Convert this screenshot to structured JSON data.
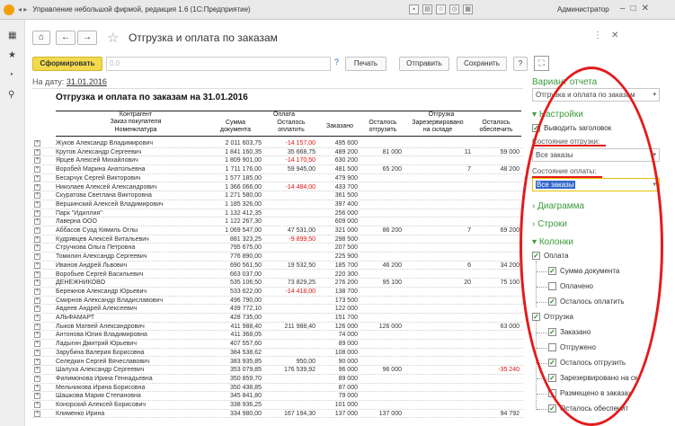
{
  "window": {
    "title": "Управление небольшой фирмой, редакция 1.6 (1С:Предприятие)",
    "user": "Администратор"
  },
  "header": {
    "title": "Отгрузка и оплата по заказам"
  },
  "toolbar": {
    "generate_label": "Сформировать",
    "field_value": "0.0",
    "help_label": "?",
    "print_label": "Печать",
    "send_label": "Отправить",
    "save_label": "Сохранить",
    "help2_label": "?"
  },
  "date_line": {
    "label": "На дату:",
    "value": "31.01.2016"
  },
  "report": {
    "title": "Отгрузка и оплата по заказам на 31.01.2016",
    "headers": {
      "counterparty": "Контрагент",
      "customer_order": "Заказ покупателя",
      "item": "Номенклатура",
      "payment": "Оплата",
      "doc_sum_1": "Сумма",
      "doc_sum_2": "документа",
      "remaining_1": "Осталось",
      "remaining_2": "оплатить",
      "ordered": "Заказано",
      "shipment": "Отгрузка",
      "to_ship_1": "Осталось",
      "to_ship_2": "отгрузить",
      "reserved_1": "Зарезервировано",
      "reserved_2": "на складе",
      "to_provide_1": "Осталось",
      "to_provide_2": "обеспечить"
    },
    "rows": [
      {
        "name": "Жуков Александр Владимирович",
        "sum": "2 011 603,75",
        "rem": "-14 157,00",
        "rem_red": true,
        "ordered": "495 600",
        "to_ship": "",
        "reserved": "",
        "to_provide": ""
      },
      {
        "name": "Крутов Александр Сергеевич",
        "sum": "1 841 160,35",
        "rem": "35 668,75",
        "rem_red": false,
        "ordered": "489 200",
        "to_ship": "81 000",
        "reserved": "11",
        "to_provide": "59 000"
      },
      {
        "name": "Ярцев Алексей Михайлович",
        "sum": "1 809 901,00",
        "rem": "-14 170,50",
        "rem_red": true,
        "ordered": "630 200",
        "to_ship": "",
        "reserved": "",
        "to_provide": ""
      },
      {
        "name": "Воробей Марина Анатольевна",
        "sum": "1 711 176,00",
        "rem": "59 945,00",
        "rem_red": false,
        "ordered": "481 500",
        "to_ship": "65 200",
        "reserved": "7",
        "to_provide": "48 200"
      },
      {
        "name": "Бесарчук Сергей Викторович",
        "sum": "1 577 185,00",
        "rem": "",
        "rem_red": false,
        "ordered": "479 900",
        "to_ship": "",
        "reserved": "",
        "to_provide": ""
      },
      {
        "name": "Николаев Алексей Александрович",
        "sum": "1 366 066,00",
        "rem": "-14 484,00",
        "rem_red": true,
        "ordered": "433 700",
        "to_ship": "",
        "reserved": "",
        "to_provide": ""
      },
      {
        "name": "Скуратова Светлана Викторовна",
        "sum": "1 271 580,00",
        "rem": "",
        "rem_red": false,
        "ordered": "361 500",
        "to_ship": "",
        "reserved": "",
        "to_provide": ""
      },
      {
        "name": "Вершинский Алексей Владимирович",
        "sum": "1 185 326,00",
        "rem": "",
        "rem_red": false,
        "ordered": "397 400",
        "to_ship": "",
        "reserved": "",
        "to_provide": ""
      },
      {
        "name": "Парк \"Идиллия\"",
        "sum": "1 132 412,35",
        "rem": "",
        "rem_red": false,
        "ordered": "256 000",
        "to_ship": "",
        "reserved": "",
        "to_provide": ""
      },
      {
        "name": "Лаверна ООО",
        "sum": "1 122 267,30",
        "rem": "",
        "rem_red": false,
        "ordered": "609 000",
        "to_ship": "",
        "reserved": "",
        "to_provide": ""
      },
      {
        "name": "Аббасов Суад Кямиль Оглы",
        "sum": "1 069 547,00",
        "rem": "47 531,00",
        "rem_red": false,
        "ordered": "321 000",
        "to_ship": "86 200",
        "reserved": "7",
        "to_provide": "69 200"
      },
      {
        "name": "Кудрявцев Алексей Витальевич",
        "sum": "881 323,25",
        "rem": "-9 899,50",
        "rem_red": true,
        "ordered": "298 500",
        "to_ship": "",
        "reserved": "",
        "to_provide": ""
      },
      {
        "name": "Стручкова Ольга Петровна",
        "sum": "795 675,00",
        "rem": "",
        "rem_red": false,
        "ordered": "207 500",
        "to_ship": "",
        "reserved": "",
        "to_provide": ""
      },
      {
        "name": "Томилин Александр Сергеевич",
        "sum": "776 890,00",
        "rem": "",
        "rem_red": false,
        "ordered": "225 900",
        "to_ship": "",
        "reserved": "",
        "to_provide": ""
      },
      {
        "name": "Иванов Андрей Львович",
        "sum": "690 561,50",
        "rem": "19 532,50",
        "rem_red": false,
        "ordered": "185 700",
        "to_ship": "46 200",
        "reserved": "6",
        "to_provide": "34 200"
      },
      {
        "name": "Воробьев Сергей Васильевич",
        "sum": "663 037,00",
        "rem": "",
        "rem_red": false,
        "ordered": "220 300",
        "to_ship": "",
        "reserved": "",
        "to_provide": ""
      },
      {
        "name": "ДЕНЕЖНИКОВО",
        "sum": "535 106,50",
        "rem": "73 829,25",
        "rem_red": false,
        "ordered": "276 200",
        "to_ship": "95 100",
        "reserved": "20",
        "to_provide": "75 100"
      },
      {
        "name": "Бережнов Александр Юрьевич",
        "sum": "533 622,00",
        "rem": "-14 418,00",
        "rem_red": true,
        "ordered": "138 700",
        "to_ship": "",
        "reserved": "",
        "to_provide": ""
      },
      {
        "name": "Смирнов Александр Владиславович",
        "sum": "496 790,00",
        "rem": "",
        "rem_red": false,
        "ordered": "173 500",
        "to_ship": "",
        "reserved": "",
        "to_provide": ""
      },
      {
        "name": "Авдеев Андрей Алексеевич",
        "sum": "439 772,10",
        "rem": "",
        "rem_red": false,
        "ordered": "122 000",
        "to_ship": "",
        "reserved": "",
        "to_provide": ""
      },
      {
        "name": "АЛЬФАМАРТ",
        "sum": "428 735,00",
        "rem": "",
        "rem_red": false,
        "ordered": "151 700",
        "to_ship": "",
        "reserved": "",
        "to_provide": ""
      },
      {
        "name": "Лыков Матвей Александрович",
        "sum": "411 988,40",
        "rem": "211 988,40",
        "rem_red": false,
        "ordered": "126 000",
        "to_ship": "126 000",
        "reserved": "",
        "to_provide": "63 000"
      },
      {
        "name": "Антонова Юлия Владимировна",
        "sum": "411 368,05",
        "rem": "",
        "rem_red": false,
        "ordered": "74 000",
        "to_ship": "",
        "reserved": "",
        "to_provide": ""
      },
      {
        "name": "Ладыгин Дмитрий Юрьевич",
        "sum": "407 557,60",
        "rem": "",
        "rem_red": false,
        "ordered": "89 000",
        "to_ship": "",
        "reserved": "",
        "to_provide": ""
      },
      {
        "name": "Зарубина Валерия Борисовна",
        "sum": "384 538,62",
        "rem": "",
        "rem_red": false,
        "ordered": "108 000",
        "to_ship": "",
        "reserved": "",
        "to_provide": ""
      },
      {
        "name": "Селедкин Сергей Вячеславович",
        "sum": "383 935,85",
        "rem": "950,00",
        "rem_red": false,
        "ordered": "90 000",
        "to_ship": "",
        "reserved": "",
        "to_provide": ""
      },
      {
        "name": "Шалуха Александр Сергеевич",
        "sum": "353 079,85",
        "rem": "176 539,92",
        "rem_red": false,
        "ordered": "96 000",
        "to_ship": "96 000",
        "reserved": "",
        "to_provide": "-35 240",
        "provide_red": true
      },
      {
        "name": "Филимонова Ирина Геннадьевна",
        "sum": "350 859,70",
        "rem": "",
        "rem_red": false,
        "ordered": "89 000",
        "to_ship": "",
        "reserved": "",
        "to_provide": ""
      },
      {
        "name": "Мельникова Ирина Борисовна",
        "sum": "350 438,85",
        "rem": "",
        "rem_red": false,
        "ordered": "87 000",
        "to_ship": "",
        "reserved": "",
        "to_provide": ""
      },
      {
        "name": "Шашкова Мария Степановна",
        "sum": "345 841,80",
        "rem": "",
        "rem_red": false,
        "ordered": "79 000",
        "to_ship": "",
        "reserved": "",
        "to_provide": ""
      },
      {
        "name": "Конорский Алексей Борисович",
        "sum": "338 936,25",
        "rem": "",
        "rem_red": false,
        "ordered": "101 000",
        "to_ship": "",
        "reserved": "",
        "to_provide": ""
      },
      {
        "name": "Клименко Ирина",
        "sum": "334 980,00",
        "rem": "167 194,30",
        "rem_red": false,
        "ordered": "137 000",
        "to_ship": "137 000",
        "reserved": "",
        "to_provide": "94 792"
      }
    ]
  },
  "settings": {
    "variant_header": "Вариант отчета",
    "variant_value": "Отгрузка и оплата по заказам",
    "settings_header": "Настройки",
    "show_title_label": "Выводить заголовок",
    "shipment_state_label": "Состояние отгрузки:",
    "shipment_state_value": "Все заказы",
    "payment_state_label": "Состояние оплаты:",
    "payment_state_value": "Все заказы",
    "diagram_label": "Диаграмма",
    "rows_label": "Строки",
    "columns_label": "Колонки",
    "col_payment": "Оплата",
    "col_doc_sum": "Сумма документа",
    "col_paid": "Оплачено",
    "col_to_pay": "Осталось оплатить",
    "col_shipment": "Отгрузка",
    "col_ordered": "Заказано",
    "col_shipped": "Отгружено",
    "col_to_ship": "Осталось отгрузить",
    "col_reserved": "Зарезервировано на ск.",
    "col_placed": "Размещено в заказах",
    "col_to_provide": "Осталось обеспечит"
  },
  "colors": {
    "accent_green": "#3a9a3a",
    "annotation_red": "#e31b1b",
    "generate_yellow": "#f2d94e"
  }
}
